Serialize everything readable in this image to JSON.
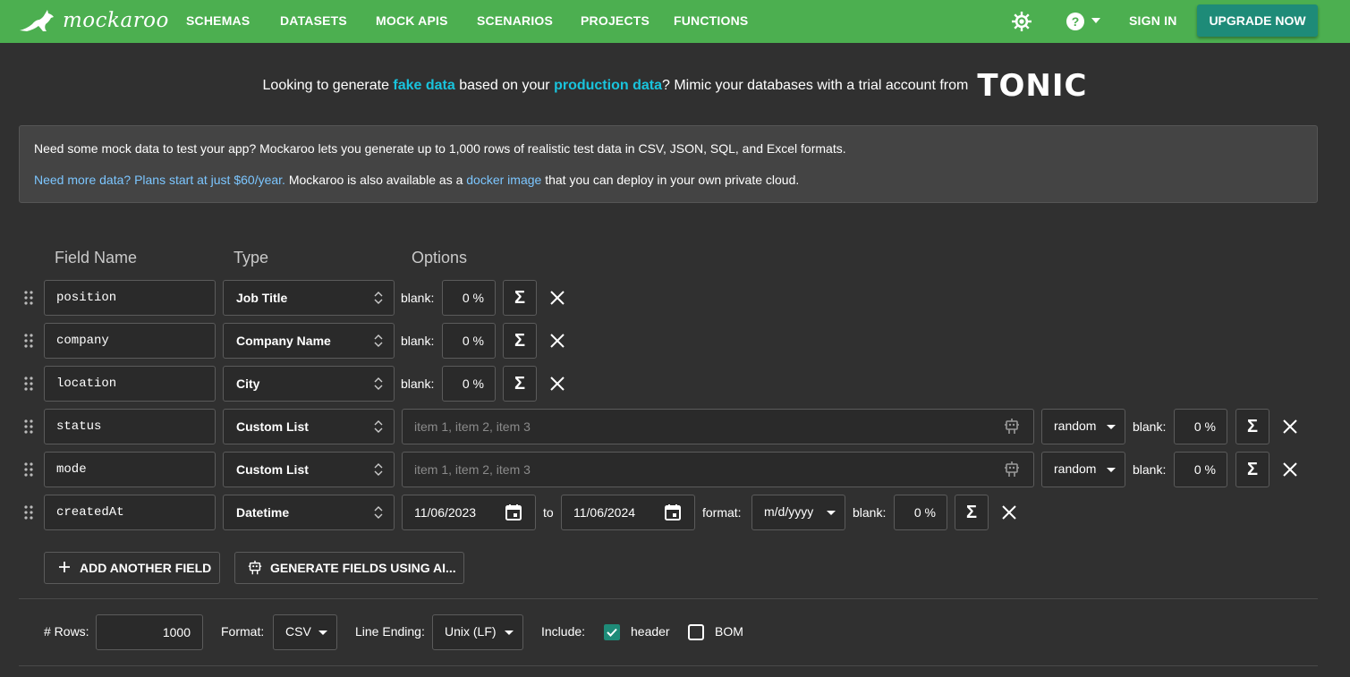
{
  "nav": {
    "brand": "mockaroo",
    "links": [
      "SCHEMAS",
      "DATASETS",
      "MOCK APIS",
      "SCENARIOS",
      "PROJECTS",
      "FUNCTIONS"
    ],
    "sign_in": "SIGN IN",
    "upgrade": "UPGRADE NOW",
    "icons": [
      "theme-icon",
      "help-icon"
    ]
  },
  "banner": {
    "pre": "Looking to generate ",
    "hl1": "fake data",
    "mid": " based on your ",
    "hl2": "production data",
    "post": "? Mimic your databases with a trial account from",
    "logo": "TONIC"
  },
  "info": {
    "line1": "Need some mock data to test your app? Mockaroo lets you generate up to 1,000 rows of realistic test data in CSV, JSON, SQL, and Excel formats.",
    "link1": "Need more data? Plans start at just $60/year.",
    "text2": " Mockaroo is also available as a ",
    "link2": "docker image",
    "text3": " that you can deploy in your own private cloud."
  },
  "headers": {
    "name": "Field Name",
    "type": "Type",
    "options": "Options"
  },
  "fields": [
    {
      "name": "position",
      "type": "Job Title",
      "blank_label": "blank:",
      "blank": "0 %"
    },
    {
      "name": "company",
      "type": "Company Name",
      "blank_label": "blank:",
      "blank": "0 %"
    },
    {
      "name": "location",
      "type": "City",
      "blank_label": "blank:",
      "blank": "0 %"
    },
    {
      "name": "status",
      "type": "Custom List",
      "placeholder": "item 1, item 2, item 3",
      "order": "random",
      "blank_label": "blank:",
      "blank": "0 %"
    },
    {
      "name": "mode",
      "type": "Custom List",
      "placeholder": "item 1, item 2, item 3",
      "order": "random",
      "blank_label": "blank:",
      "blank": "0 %"
    },
    {
      "name": "createdAt",
      "type": "Datetime",
      "from": "11/06/2023",
      "to_label": "to",
      "to": "11/06/2024",
      "format_label": "format:",
      "format": "m/d/yyyy",
      "blank_label": "blank:",
      "blank": "0 %"
    }
  ],
  "actions": {
    "add": "ADD ANOTHER FIELD",
    "ai": "GENERATE FIELDS USING AI..."
  },
  "bottom": {
    "rows_label": "# Rows:",
    "rows": "1000",
    "format_label": "Format:",
    "format": "CSV",
    "line_ending_label": "Line Ending:",
    "line_ending": "Unix (LF)",
    "include_label": "Include:",
    "header_label": "header",
    "header_checked": true,
    "bom_label": "BOM",
    "bom_checked": false
  },
  "colors": {
    "nav": "#4caf50",
    "upgrade": "#1e8b78",
    "highlight": "#19c3dc",
    "link": "#7cc6ff",
    "check": "#1e8b78"
  }
}
